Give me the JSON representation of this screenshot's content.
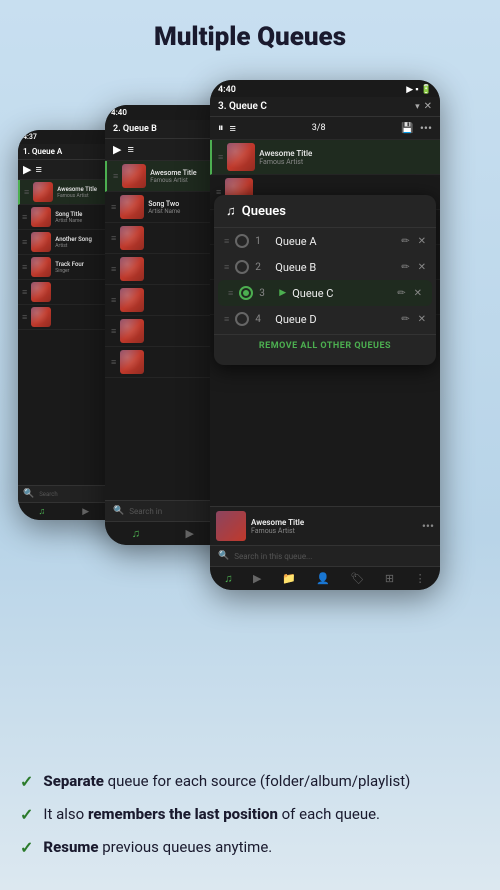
{
  "page": {
    "title": "Multiple Queues",
    "background_gradient_start": "#c8dff0",
    "background_gradient_end": "#dce8f0"
  },
  "phones": [
    {
      "id": "phone-1",
      "time": "4:37",
      "queue_name": "1. Queue A",
      "track_count": ""
    },
    {
      "id": "phone-2",
      "time": "4:40",
      "queue_name": "2. Queue B",
      "track_count": ""
    },
    {
      "id": "phone-3",
      "time": "4:40",
      "queue_name": "3. Queue C",
      "track_count": "3/8"
    }
  ],
  "queues_popup": {
    "title": "Queues",
    "queues": [
      {
        "number": "1",
        "name": "Queue A",
        "selected": false,
        "playing": false
      },
      {
        "number": "2",
        "name": "Queue B",
        "selected": false,
        "playing": false
      },
      {
        "number": "3",
        "name": "Queue C",
        "selected": true,
        "playing": true
      },
      {
        "number": "4",
        "name": "Queue D",
        "selected": false,
        "playing": false
      }
    ],
    "remove_all_label": "REMOVE ALL OTHER QUEUES"
  },
  "now_playing": {
    "title": "Awesome Title",
    "artist": "Famous Artist"
  },
  "search": {
    "placeholder": "Search in this queue..."
  },
  "features": [
    {
      "bold_part": "Separate",
      "rest": " queue for each source (folder/album/playlist)"
    },
    {
      "bold_part": null,
      "prefix": "It also ",
      "bold_middle": "remembers the last position",
      "rest": " of each queue."
    },
    {
      "bold_part": "Resume",
      "rest": " previous queues anytime."
    }
  ]
}
